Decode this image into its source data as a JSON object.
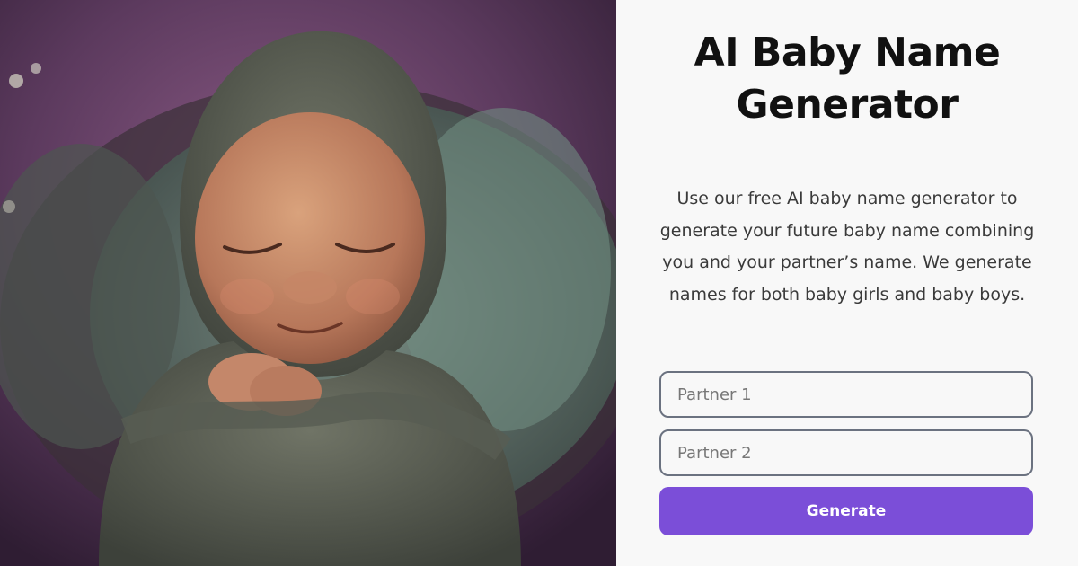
{
  "hero": {
    "image_alt": "sleeping newborn baby wrapped in knitted wrap and bonnet"
  },
  "header": {
    "title_line1": "AI Baby Name",
    "title_line2": "Generator"
  },
  "description": {
    "text": "Use our free AI baby name generator to generate your future baby name combining you and your partner’s name. We generate names for both baby girls and baby boys."
  },
  "form": {
    "partner1": {
      "placeholder": "Partner 1",
      "value": ""
    },
    "partner2": {
      "placeholder": "Partner 2",
      "value": ""
    },
    "submit_label": "Generate"
  },
  "colors": {
    "accent": "#7b4ed8",
    "field_border": "#6b7280",
    "panel_background": "#f8f8f8",
    "title_text": "#111111"
  }
}
